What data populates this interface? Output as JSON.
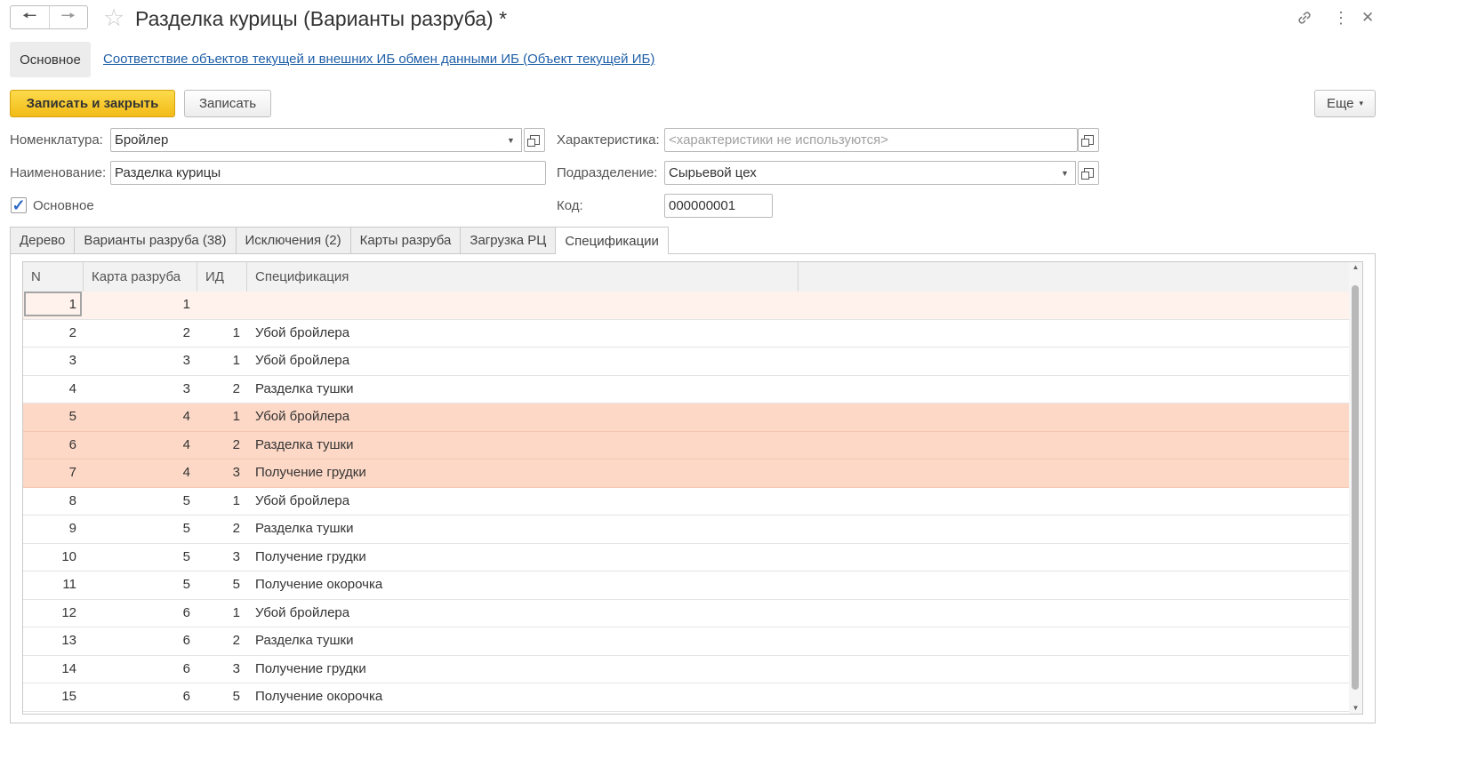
{
  "window": {
    "title": "Разделка курицы (Варианты разруба) *",
    "back_icon": "arrow-left-icon",
    "forward_icon": "arrow-right-icon",
    "favorite_icon": "star-icon",
    "link_icon": "link-icon",
    "more_icon": "vertical-dots-icon",
    "close_icon": "close-icon"
  },
  "sections": {
    "main": "Основное",
    "link": "Соответствие объектов текущей и внешних ИБ обмен данными ИБ (Объект текущей ИБ)"
  },
  "toolbar": {
    "save_close": "Записать и закрыть",
    "save": "Записать",
    "more": "Еще",
    "more_arrow": "▾"
  },
  "form": {
    "nomenclature_label": "Номенклатура:",
    "nomenclature_value": "Бройлер",
    "name_label": "Наименование:",
    "name_value": "Разделка курицы",
    "main_checkbox_label": "Основное",
    "main_checked": true,
    "characteristic_label": "Характеристика:",
    "characteristic_placeholder": "<характеристики не используются>",
    "department_label": "Подразделение:",
    "department_value": "Сырьевой цех",
    "code_label": "Код:",
    "code_value": "000000001"
  },
  "tabs": [
    {
      "label": "Дерево"
    },
    {
      "label": "Варианты разруба (38)"
    },
    {
      "label": "Исключения (2)"
    },
    {
      "label": "Карты разруба"
    },
    {
      "label": "Загрузка РЦ"
    },
    {
      "label": "Спецификации",
      "active": true
    }
  ],
  "table": {
    "columns": [
      "N",
      "Карта разруба",
      "ИД",
      "Спецификация"
    ],
    "rows": [
      {
        "n": "1",
        "card": "1",
        "id": "",
        "spec": "",
        "state": "current"
      },
      {
        "n": "2",
        "card": "2",
        "id": "1",
        "spec": "Убой бройлера",
        "state": ""
      },
      {
        "n": "3",
        "card": "3",
        "id": "1",
        "spec": "Убой бройлера",
        "state": ""
      },
      {
        "n": "4",
        "card": "3",
        "id": "2",
        "spec": "Разделка тушки",
        "state": ""
      },
      {
        "n": "5",
        "card": "4",
        "id": "1",
        "spec": "Убой бройлера",
        "state": "highlight"
      },
      {
        "n": "6",
        "card": "4",
        "id": "2",
        "spec": "Разделка тушки",
        "state": "highlight"
      },
      {
        "n": "7",
        "card": "4",
        "id": "3",
        "spec": "Получение грудки",
        "state": "highlight"
      },
      {
        "n": "8",
        "card": "5",
        "id": "1",
        "spec": "Убой бройлера",
        "state": ""
      },
      {
        "n": "9",
        "card": "5",
        "id": "2",
        "spec": "Разделка тушки",
        "state": ""
      },
      {
        "n": "10",
        "card": "5",
        "id": "3",
        "spec": "Получение грудки",
        "state": ""
      },
      {
        "n": "11",
        "card": "5",
        "id": "5",
        "spec": "Получение окорочка",
        "state": ""
      },
      {
        "n": "12",
        "card": "6",
        "id": "1",
        "spec": "Убой бройлера",
        "state": ""
      },
      {
        "n": "13",
        "card": "6",
        "id": "2",
        "spec": "Разделка тушки",
        "state": ""
      },
      {
        "n": "14",
        "card": "6",
        "id": "3",
        "spec": "Получение грудки",
        "state": ""
      },
      {
        "n": "15",
        "card": "6",
        "id": "5",
        "spec": "Получение окорочка",
        "state": ""
      }
    ]
  }
}
